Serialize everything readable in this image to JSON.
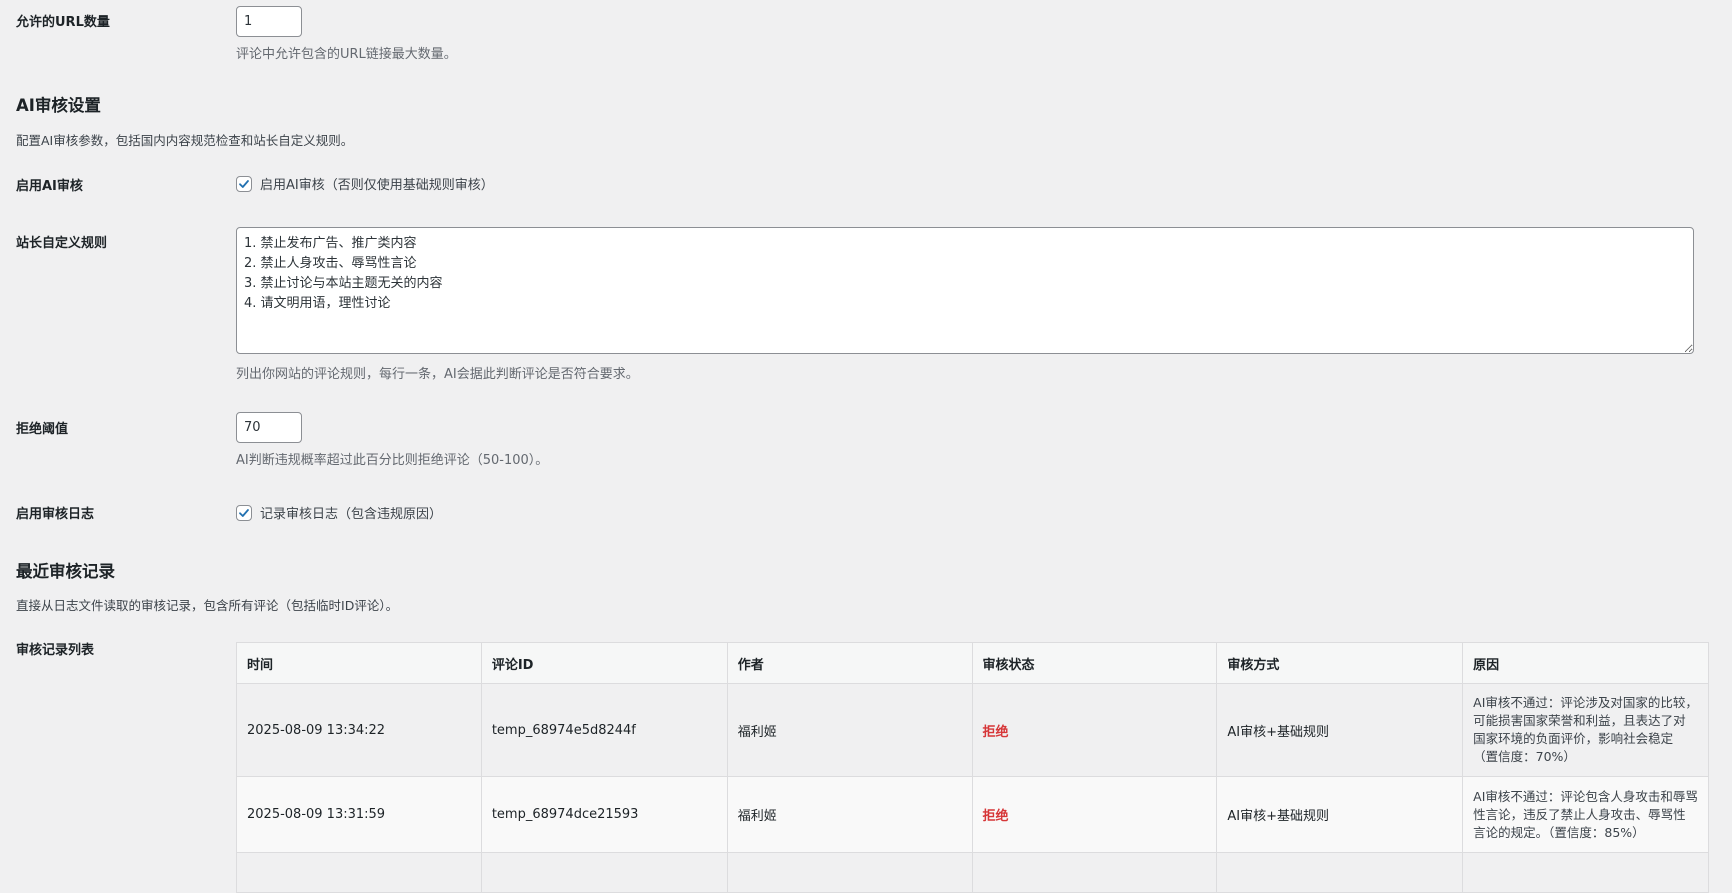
{
  "url_count": {
    "label": "允许的URL数量",
    "value": "1",
    "description": "评论中允许包含的URL链接最大数量。"
  },
  "ai_section": {
    "title": "AI审核设置",
    "description": "配置AI审核参数，包括国内内容规范检查和站长自定义规则。",
    "enable_ai": {
      "label": "启用AI审核",
      "checkbox_label": "启用AI审核（否则仅使用基础规则审核）",
      "checked": true
    },
    "custom_rules": {
      "label": "站长自定义规则",
      "value": "1. 禁止发布广告、推广类内容\n2. 禁止人身攻击、辱骂性言论\n3. 禁止讨论与本站主题无关的内容\n4. 请文明用语，理性讨论",
      "description": "列出你网站的评论规则，每行一条，AI会据此判断评论是否符合要求。"
    },
    "threshold": {
      "label": "拒绝阈值",
      "value": "70",
      "description": "AI判断违规概率超过此百分比则拒绝评论（50-100）。"
    },
    "enable_log": {
      "label": "启用审核日志",
      "checkbox_label": "记录审核日志（包含违规原因）",
      "checked": true
    }
  },
  "records_section": {
    "title": "最近审核记录",
    "description": "直接从日志文件读取的审核记录，包含所有评论（包括临时ID评论）。",
    "list_label": "审核记录列表",
    "columns": [
      "时间",
      "评论ID",
      "作者",
      "审核状态",
      "审核方式",
      "原因"
    ],
    "rows": [
      {
        "time": "2025-08-09 13:34:22",
        "comment_id": "temp_68974e5d8244f",
        "author": "福利姬",
        "status": "拒绝",
        "method": "AI审核+基础规则",
        "reason": "AI审核不通过：评论涉及对国家的比较，可能损害国家荣誉和利益，且表达了对国家环境的负面评价，影响社会稳定（置信度：70%）"
      },
      {
        "time": "2025-08-09 13:31:59",
        "comment_id": "temp_68974dce21593",
        "author": "福利姬",
        "status": "拒绝",
        "method": "AI审核+基础规则",
        "reason": "AI审核不通过：评论包含人身攻击和辱骂性言论，违反了禁止人身攻击、辱骂性言论的规定。（置信度：85%）"
      }
    ]
  },
  "colors": {
    "rejected": "#d63638",
    "checkbox_check": "#2271b1"
  }
}
